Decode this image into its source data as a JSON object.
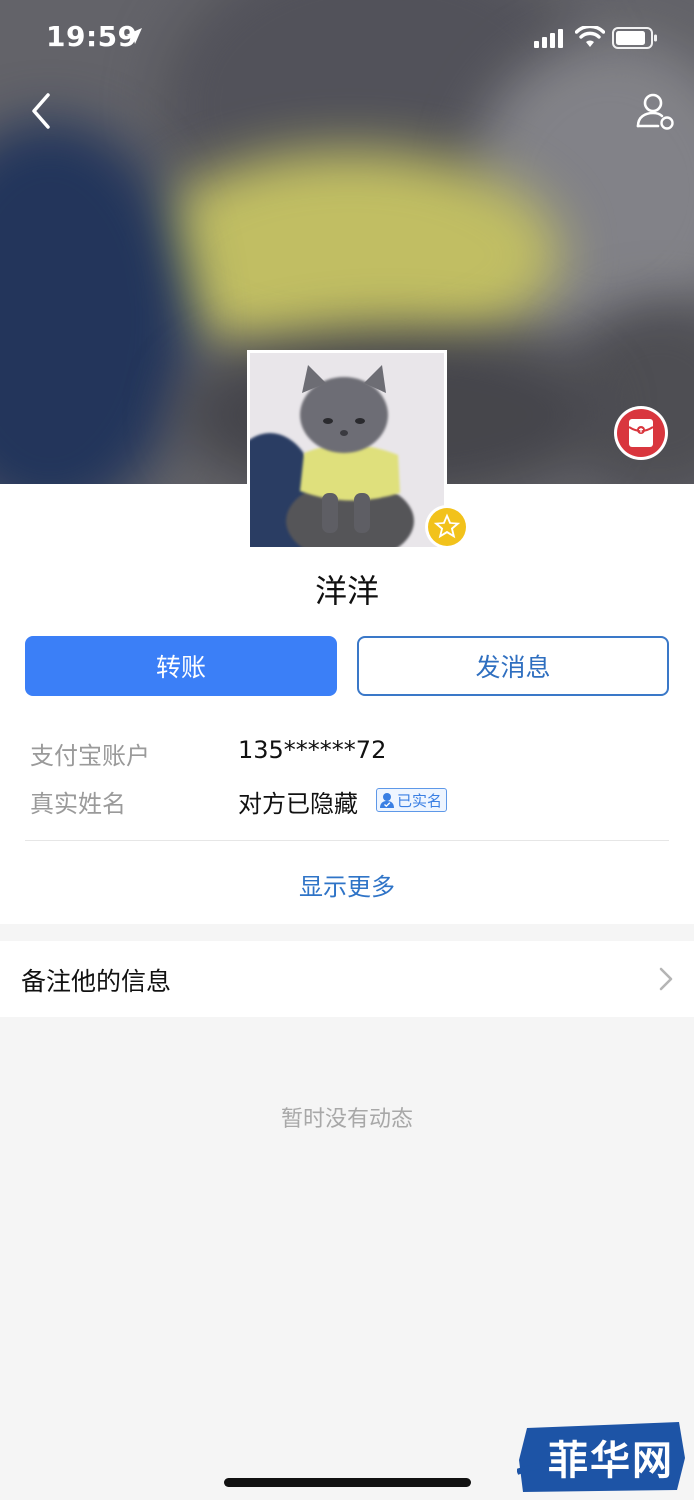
{
  "status_bar": {
    "time": "19:59"
  },
  "profile": {
    "nickname": "洋洋",
    "has_star_badge": true
  },
  "actions": {
    "transfer_label": "转账",
    "message_label": "发消息"
  },
  "info": {
    "account_label": "支付宝账户",
    "account_value": "135******72",
    "realname_label": "真实姓名",
    "realname_value": "对方已隐藏",
    "verified_label": "已实名"
  },
  "show_more_label": "显示更多",
  "remark": {
    "label": "备注他的信息"
  },
  "feed": {
    "empty_text": "暂时没有动态"
  },
  "watermark": {
    "text": "菲华网"
  },
  "colors": {
    "primary": "#3b7ff7",
    "link": "#2f74c7",
    "red_packet": "#d9363e",
    "star": "#f2c21b"
  }
}
